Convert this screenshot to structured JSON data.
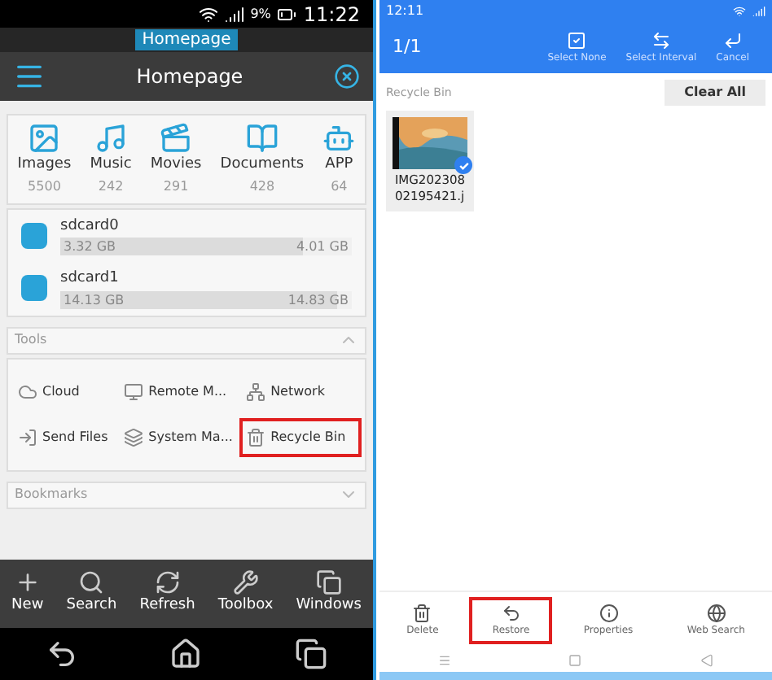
{
  "left": {
    "status_bar": {
      "battery": "9%",
      "time": "11:22"
    },
    "window_tabs": [
      {
        "label": "Homepage",
        "selected": true
      }
    ],
    "header": {
      "title": "Homepage"
    },
    "categories": [
      {
        "kind": "images",
        "label": "Images",
        "count": "5500"
      },
      {
        "kind": "music",
        "label": "Music",
        "count": "242"
      },
      {
        "kind": "movies",
        "label": "Movies",
        "count": "291"
      },
      {
        "kind": "documents",
        "label": "Documents",
        "count": "428"
      },
      {
        "kind": "app",
        "label": "APP",
        "count": "64"
      }
    ],
    "storage": [
      {
        "name": "sdcard0",
        "used": "3.32 GB",
        "total": "4.01 GB",
        "level": 0.83
      },
      {
        "name": "sdcard1",
        "used": "14.13 GB",
        "total": "14.83 GB",
        "level": 0.95
      }
    ],
    "tools": {
      "title": "Tools",
      "expanded": true,
      "items": [
        {
          "kind": "cloud",
          "label": "Cloud",
          "highlighted": false
        },
        {
          "kind": "remote",
          "label": "Remote M...",
          "highlighted": false
        },
        {
          "kind": "network",
          "label": "Network",
          "highlighted": false
        },
        {
          "kind": "send",
          "label": "Send Files",
          "highlighted": false
        },
        {
          "kind": "system",
          "label": "System Ma...",
          "highlighted": false
        },
        {
          "kind": "recycle",
          "label": "Recycle Bin",
          "highlighted": true
        }
      ]
    },
    "bookmarks": {
      "title": "Bookmarks",
      "expanded": false
    },
    "toolbar": [
      {
        "kind": "new",
        "label": "New"
      },
      {
        "kind": "search",
        "label": "Search"
      },
      {
        "kind": "refresh",
        "label": "Refresh"
      },
      {
        "kind": "toolbox",
        "label": "Toolbox"
      },
      {
        "kind": "windows",
        "label": "Windows"
      }
    ]
  },
  "right": {
    "status_bar": {
      "time": "12:11"
    },
    "toolbar": {
      "count": "1/1",
      "actions": [
        {
          "kind": "select_none",
          "label": "Select None"
        },
        {
          "kind": "select_interval",
          "label": "Select Interval"
        },
        {
          "kind": "cancel",
          "label": "Cancel"
        }
      ]
    },
    "section": "Recycle Bin",
    "clear_button": "Clear All",
    "files": [
      {
        "name": "IMG202308\n02195421.j",
        "checked": true
      }
    ],
    "actions": [
      {
        "kind": "delete",
        "label": "Delete",
        "highlighted": false
      },
      {
        "kind": "restore",
        "label": "Restore",
        "highlighted": true
      },
      {
        "kind": "properties",
        "label": "Properties",
        "highlighted": false
      },
      {
        "kind": "web_search",
        "label": "Web Search",
        "highlighted": false
      }
    ]
  }
}
